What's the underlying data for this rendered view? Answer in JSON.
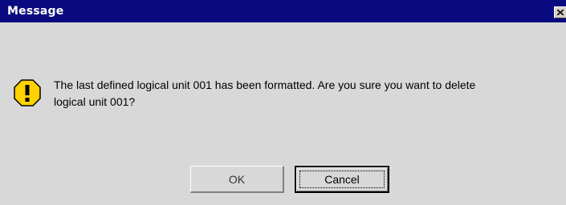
{
  "window": {
    "title": "Message",
    "titlebar_color": "#0a0a80",
    "background_color": "#d4d4d4",
    "close_icon": "close-icon"
  },
  "message": {
    "icon": "warning-icon",
    "icon_color": "#ffd200",
    "line1": "The last defined logical unit 001 has been formatted. Are you sure you want to delete",
    "line2": "logical unit 001?"
  },
  "buttons": {
    "ok_label": "OK",
    "cancel_label": "Cancel",
    "default_button": "Cancel"
  }
}
